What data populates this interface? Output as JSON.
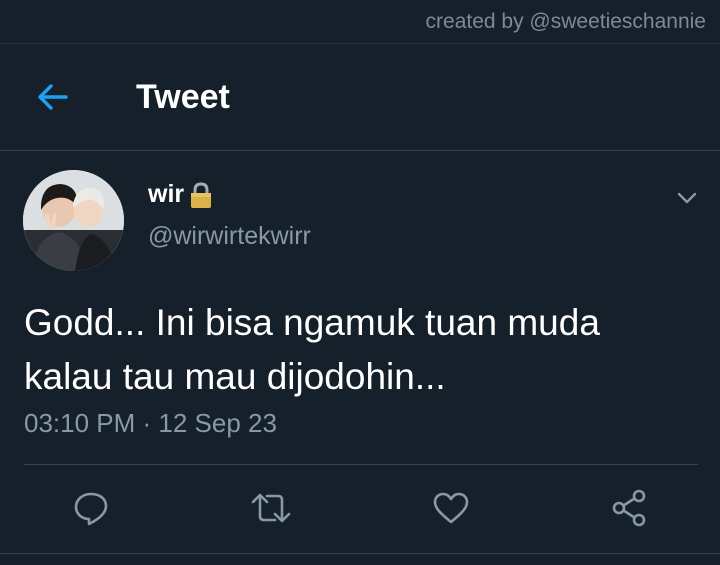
{
  "watermark": "created by @sweetieschannie",
  "header": {
    "title": "Tweet",
    "back_icon": "arrow-left-icon"
  },
  "tweet": {
    "author_name": "wir",
    "protected_icon": "lock-icon",
    "handle": "@wirwirtekwirr",
    "text_line1": "Godd... Ini bisa ngamuk tuan muda",
    "text_line2": "kalau tau mau dijodohin...",
    "timestamp": "03:10 PM · 12 Sep 23"
  },
  "actions": [
    "reply-icon",
    "retweet-icon",
    "like-icon",
    "share-icon"
  ],
  "colors": {
    "background": "#15202b",
    "accent": "#1da1f2",
    "secondary_text": "#8899a6",
    "divider": "#38444d"
  }
}
